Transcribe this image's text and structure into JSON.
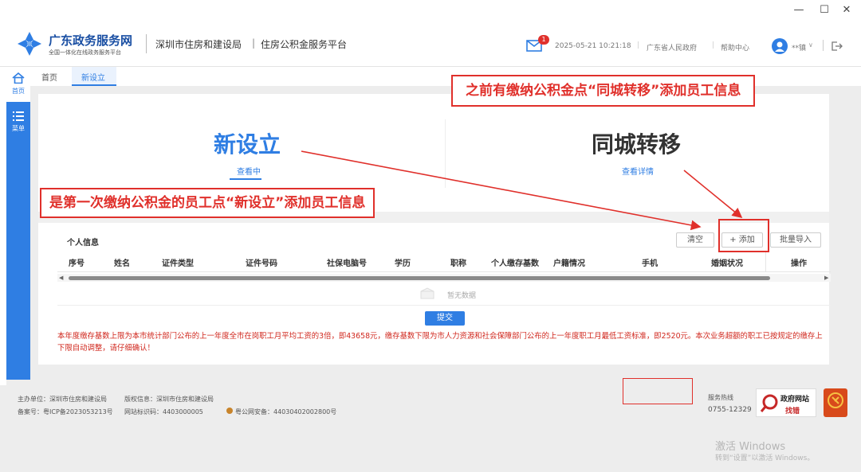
{
  "window": {
    "minimize": "—",
    "maximize": "☐",
    "close": "✕"
  },
  "header": {
    "logo_title": "广东政务服务网",
    "logo_subtitle": "全国一体化在线政务服务平台",
    "breadcrumb_1": "深圳市住房和建设局",
    "breadcrumb_2": "住房公积金服务平台",
    "mail_badge": "1",
    "datetime": "2025-05-21 10:21:18",
    "link_gov": "广东省人民政府",
    "link_help": "帮助中心",
    "user_name": "**镇"
  },
  "sidebar": {
    "items": [
      {
        "label": "首页",
        "icon": "home-icon"
      },
      {
        "label": "菜单",
        "icon": "menu-icon"
      }
    ]
  },
  "tabs": [
    {
      "label": "首页"
    },
    {
      "label": "新设立"
    }
  ],
  "main": {
    "option_new": {
      "title": "新设立",
      "subtitle": "查看中"
    },
    "option_transfer": {
      "title": "同城转移",
      "subtitle": "查看详情"
    }
  },
  "annotations": {
    "top": "之前有缴纳公积金点“同城转移”添加员工信息",
    "left": "是第一次缴纳公积金的员工点“新设立”添加员工信息"
  },
  "section": {
    "title": "个人信息",
    "btn_clear": "清空",
    "btn_add": "+ 添加",
    "btn_import": "批量导入"
  },
  "table": {
    "columns": [
      "序号",
      "姓名",
      "证件类型",
      "证件号码",
      "社保电脑号",
      "学历",
      "职称",
      "个人缴存基数",
      "户籍情况",
      "手机",
      "婚姻状况",
      "操作"
    ],
    "empty_text": "暂无数据"
  },
  "submit_label": "提交",
  "notice": "本年度缴存基数上限为本市统计部门公布的上一年度全市在岗职工月平均工资的3倍，即43658元，缴存基数下限为市人力资源和社会保障部门公布的上一年度职工月最低工资标准，即2520元。本次业务超额的职工已按规定的缴存上下限自动调整，请仔细确认！",
  "footer": {
    "host": "主办单位：深圳市住房和建设局",
    "copyright": "版权信息：深圳市住房和建设局",
    "icp": "备案号：粤ICP备2023053213号",
    "site_id": "网站标识码：4403000005",
    "police": "粤公网安备：44030402002800号",
    "service_label": "服务热线",
    "service_phone": "0755-12329",
    "gov_site_1": "政府网站",
    "gov_site_2": "找错"
  },
  "watermark": {
    "line1": "激活 Windows",
    "line2": "转到“设置”以激活 Windows。"
  },
  "colors": {
    "primary": "#2f7ee3",
    "annotation_red": "#e0302b",
    "notice_red": "#d0271d"
  }
}
